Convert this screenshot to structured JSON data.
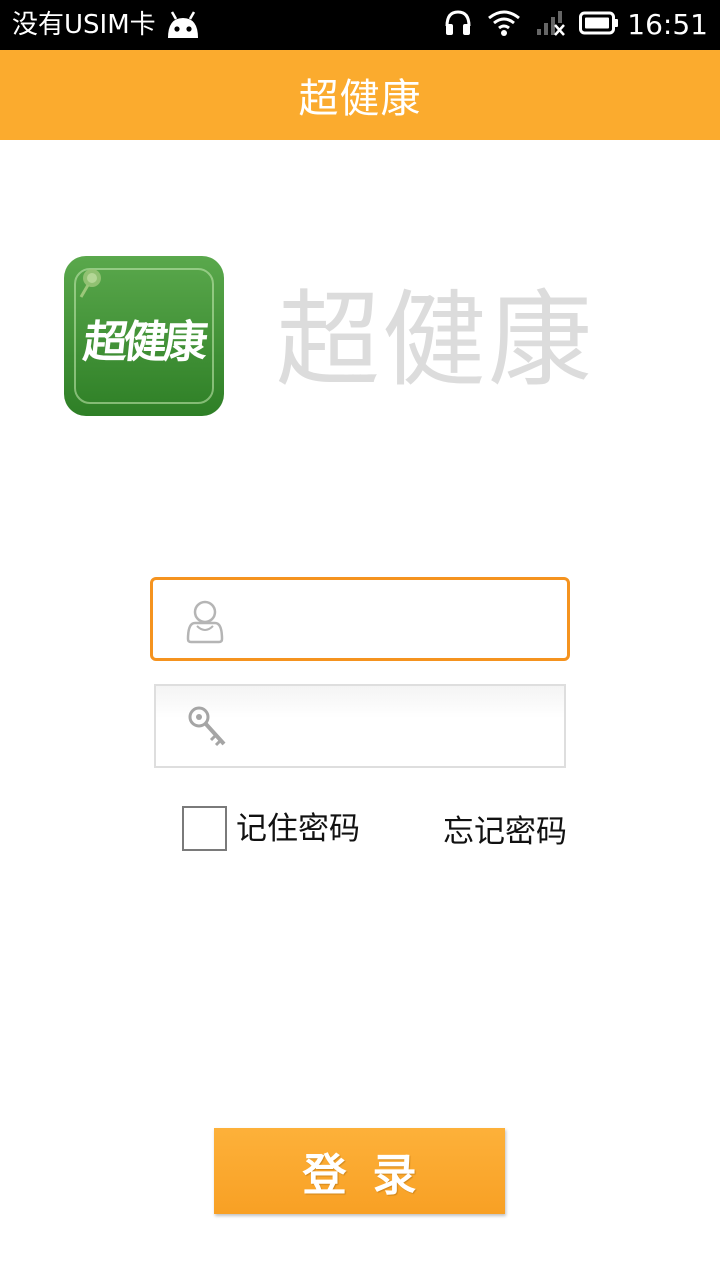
{
  "status_bar": {
    "carrier": "没有USIM卡",
    "time": "16:51",
    "icons": [
      "android-icon",
      "headset-icon",
      "wifi-icon",
      "signal-off-icon",
      "battery-icon"
    ]
  },
  "app_bar": {
    "title": "超健康"
  },
  "logo": {
    "icon_text": "超健康",
    "brand_text": "超健康",
    "colors": {
      "icon_top": "#5aa84c",
      "icon_bottom": "#2e7f26",
      "brand_text": "#dcdcdc"
    }
  },
  "form": {
    "username": {
      "value": "",
      "placeholder": "",
      "icon": "user-icon"
    },
    "password": {
      "value": "",
      "placeholder": "",
      "icon": "key-icon"
    },
    "remember_label": "记住密码",
    "remember_checked": false,
    "forgot_label": "忘记密码",
    "login_label": "登录"
  },
  "colors": {
    "accent": "#fbab2e",
    "focus_border": "#f5931f",
    "button": "#f8a024"
  }
}
